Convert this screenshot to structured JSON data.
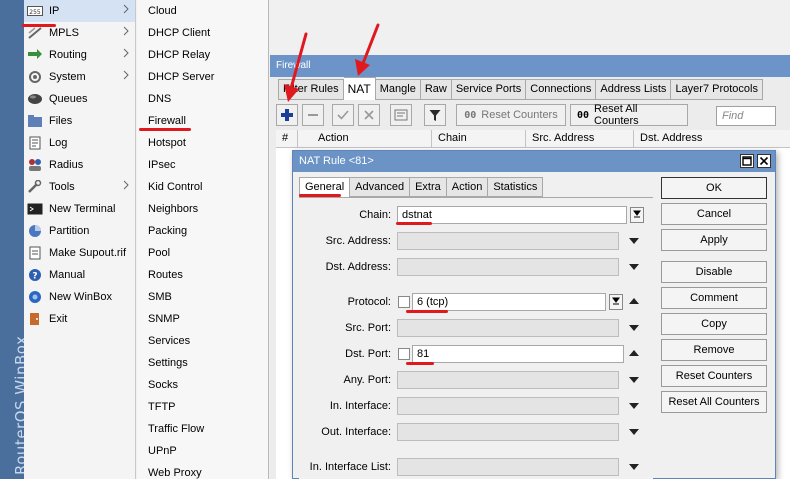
{
  "brand": "RouterOS WinBox",
  "main_menu": [
    {
      "label": "IP",
      "icon": "ip-icon",
      "arrow": true,
      "selected": true
    },
    {
      "label": "MPLS",
      "icon": "mpls-icon",
      "arrow": true
    },
    {
      "label": "Routing",
      "icon": "routing-icon",
      "arrow": true
    },
    {
      "label": "System",
      "icon": "system-icon",
      "arrow": true
    },
    {
      "label": "Queues",
      "icon": "queues-icon",
      "arrow": false
    },
    {
      "label": "Files",
      "icon": "files-icon",
      "arrow": false
    },
    {
      "label": "Log",
      "icon": "log-icon",
      "arrow": false
    },
    {
      "label": "Radius",
      "icon": "radius-icon",
      "arrow": false
    },
    {
      "label": "Tools",
      "icon": "tools-icon",
      "arrow": true
    },
    {
      "label": "New Terminal",
      "icon": "terminal-icon",
      "arrow": false
    },
    {
      "label": "Partition",
      "icon": "partition-icon",
      "arrow": false
    },
    {
      "label": "Make Supout.rif",
      "icon": "supout-icon",
      "arrow": false
    },
    {
      "label": "Manual",
      "icon": "manual-icon",
      "arrow": false
    },
    {
      "label": "New WinBox",
      "icon": "winbox-icon",
      "arrow": false
    },
    {
      "label": "Exit",
      "icon": "exit-icon",
      "arrow": false
    }
  ],
  "sub_menu": [
    "Cloud",
    "DHCP Client",
    "DHCP Relay",
    "DHCP Server",
    "DNS",
    "Firewall",
    "Hotspot",
    "IPsec",
    "Kid Control",
    "Neighbors",
    "Packing",
    "Pool",
    "Routes",
    "SMB",
    "SNMP",
    "Services",
    "Settings",
    "Socks",
    "TFTP",
    "Traffic Flow",
    "UPnP",
    "Web Proxy"
  ],
  "firewall": {
    "title": "Firewall",
    "tabs": [
      "Filter Rules",
      "NAT",
      "Mangle",
      "Raw",
      "Service Ports",
      "Connections",
      "Address Lists",
      "Layer7 Protocols"
    ],
    "active_tab": "NAT",
    "reset_counters": "Reset Counters",
    "reset_all_counters": "Reset All Counters",
    "find_placeholder": "Find",
    "columns": [
      "#",
      "Action",
      "Chain",
      "Src. Address",
      "Dst. Address"
    ]
  },
  "dialog": {
    "title": "NAT Rule <81>",
    "tabs": [
      "General",
      "Advanced",
      "Extra",
      "Action",
      "Statistics"
    ],
    "active_tab": "General",
    "fields": {
      "chain": {
        "label": "Chain:",
        "value": "dstnat"
      },
      "src_address": {
        "label": "Src. Address:",
        "value": ""
      },
      "dst_address": {
        "label": "Dst. Address:",
        "value": ""
      },
      "protocol": {
        "label": "Protocol:",
        "value": "6 (tcp)"
      },
      "src_port": {
        "label": "Src. Port:",
        "value": ""
      },
      "dst_port": {
        "label": "Dst. Port:",
        "value": "81"
      },
      "any_port": {
        "label": "Any. Port:",
        "value": ""
      },
      "in_interface": {
        "label": "In. Interface:",
        "value": ""
      },
      "out_interface": {
        "label": "Out. Interface:",
        "value": ""
      },
      "in_interface_list": {
        "label": "In. Interface List:",
        "value": ""
      }
    },
    "buttons": {
      "ok": "OK",
      "cancel": "Cancel",
      "apply": "Apply",
      "disable": "Disable",
      "comment": "Comment",
      "copy": "Copy",
      "remove": "Remove",
      "reset_counters": "Reset Counters",
      "reset_all_counters": "Reset All Counters"
    }
  },
  "colors": {
    "titlebar": "#6d94c8",
    "annotation": "#e0191f",
    "brand_strip": "#4a6f9c"
  }
}
